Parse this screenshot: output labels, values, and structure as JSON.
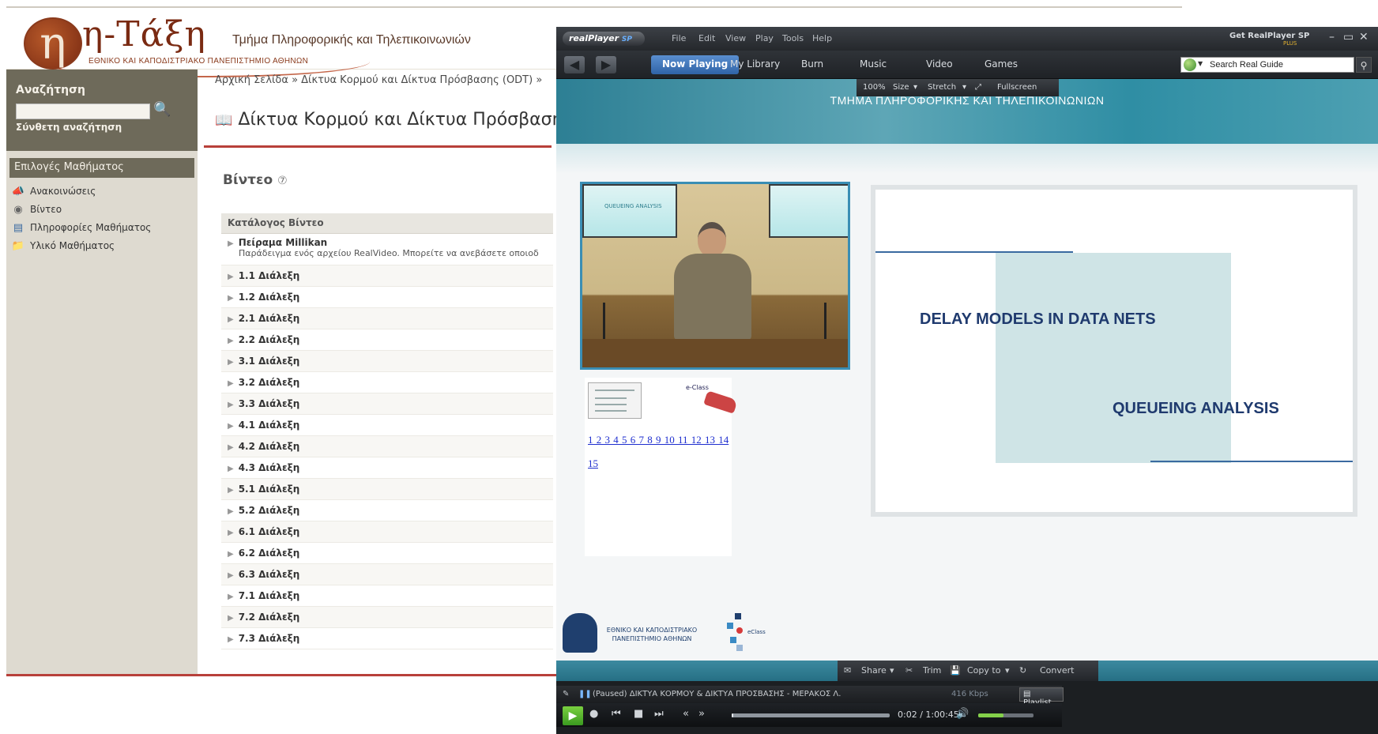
{
  "browser": {
    "logo_glyph": "η",
    "logo_title": "η-Τάξη",
    "department": "Τμήμα Πληροφορικής και Τηλεπικοινωνιών",
    "university": "ΕΘΝΙΚΟ ΚΑΙ ΚΑΠΟΔΙΣΤΡΙΑΚΟ ΠΑΝΕΠΙΣΤΗΜΙΟ ΑΘΗΝΩΝ",
    "sidebar": {
      "search_title": "Αναζήτηση",
      "search_value": "",
      "advanced_search": "Σύνθετη αναζήτηση",
      "options_title": "Επιλογές Μαθήματος",
      "items": [
        {
          "label": "Ανακοινώσεις",
          "icon": "megaphone-icon"
        },
        {
          "label": "Βίντεο",
          "icon": "film-reel-icon"
        },
        {
          "label": "Πληροφορίες Μαθήματος",
          "icon": "info-sheet-icon"
        },
        {
          "label": "Υλικό Μαθήματος",
          "icon": "folder-icon"
        }
      ]
    },
    "breadcrumb": "Αρχική Σελίδα  »  Δίκτυα Κορμού και Δίκτυα Πρόσβασης (ODT)  »",
    "page_title": "Δίκτυα Κορμού και Δίκτυα Πρόσβασης (Ο",
    "video_heading": "Βίντεο",
    "help_glyph": "⑦",
    "catalog": {
      "header": "Κατάλογος Βίντεο",
      "first_title": "Πείραμα Millikan",
      "first_desc": "Παράδειγμα ενός αρχείου RealVideo. Μπορείτε να ανεβάσετε οποιοδ",
      "rows": [
        "1.1 Διάλεξη",
        "1.2 Διάλεξη",
        "2.1 Διάλεξη",
        "2.2 Διάλεξη",
        "3.1 Διάλεξη",
        "3.2 Διάλεξη",
        "3.3 Διάλεξη",
        "4.1 Διάλεξη",
        "4.2 Διάλεξη",
        "4.3 Διάλεξη",
        "5.1 Διάλεξη",
        "5.2 Διάλεξη",
        "6.1 Διάλεξη",
        "6.2 Διάλεξη",
        "6.3 Διάλεξη",
        "7.1 Διάλεξη",
        "7.2 Διάλεξη",
        "7.3 Διάλεξη"
      ]
    }
  },
  "player": {
    "logo_text": "real",
    "logo_suffix": "Player",
    "logo_badge": "SP",
    "menu": [
      "File",
      "Edit",
      "View",
      "Play",
      "Tools",
      "Help"
    ],
    "get_label": "Get RealPlayer SP",
    "get_plus": "PLUS",
    "tabs": [
      "Now Playing",
      "My Library",
      "Burn",
      "Music",
      "Video",
      "Games"
    ],
    "search_placeholder": "Search Real Guide",
    "zoom": {
      "percent": "100%",
      "size": "Size",
      "stretch": "Stretch",
      "fullscreen": "Fullscreen"
    },
    "banner": "ΤΜΗΜΑ ΠΛΗΡΟΦΟΡΙΚΗΣ ΚΑΙ ΤΗΛΕΠΙΚΟΙΝΩΝΙΩΝ",
    "cam_screen_text": "QUEUEING ANALYSIS",
    "thumb2_label": "e-Class",
    "slide_links": "1 2 3 4 5 6 7 8 9 10 11 12 13 14  15",
    "slide": {
      "title": "DELAY MODELS IN DATA NETS",
      "subtitle": "QUEUEING ANALYSIS"
    },
    "uni_logo_text": "ΕΘΝΙΚΟ ΚΑΙ ΚΑΠΟΔΙΣΤΡΙΑΚΟ ΠΑΝΕΠΙΣΤΗΜΙΟ ΑΘΗΝΩΝ",
    "eclass_logo_text": "eClass",
    "tools": {
      "share": "Share",
      "trim": "Trim",
      "copy": "Copy to",
      "convert": "Convert"
    },
    "status": "(Paused) ΔΙΚΤΥΑ ΚΟΡΜΟΥ & ΔΙΚΤΥΑ ΠΡΟΣΒΑΣΗΣ - ΜΕΡΑΚΟΣ Λ.",
    "bitrate": "416 Kbps",
    "playlist": "Playlist",
    "time": "0:02 / 1:00:45",
    "seek_progress": 0.001,
    "volume_level": 0.45
  }
}
